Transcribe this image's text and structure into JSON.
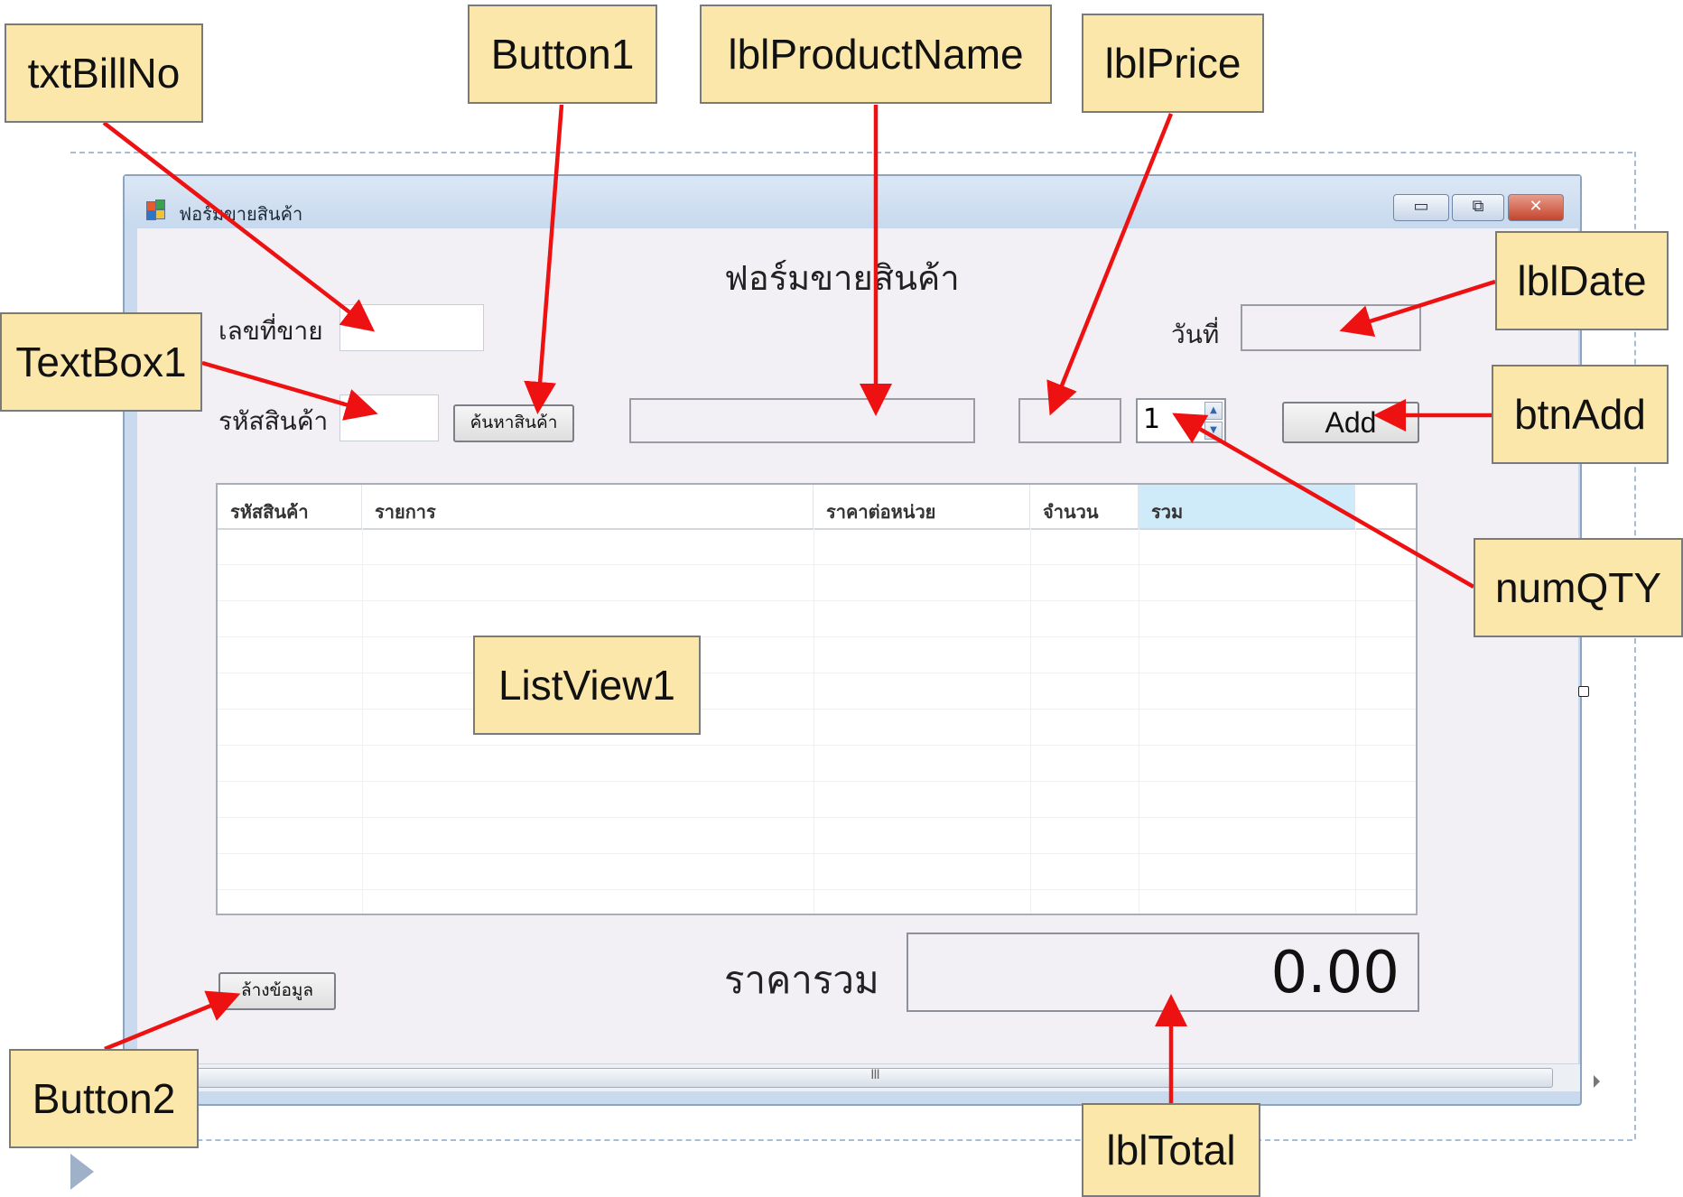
{
  "window": {
    "title": "ฟอร์มขายสินค้า",
    "controls": {
      "minimize": "▭",
      "restore": "⧉",
      "close": "✕"
    }
  },
  "form": {
    "heading": "ฟอร์มขายสินค้า",
    "bill_label": "เลขที่ขาย",
    "product_code_label": "รหัสสินค้า",
    "search_button": "ค้นหาสินค้า",
    "date_label": "วันที่",
    "qty_value": "1",
    "add_button": "Add",
    "clear_button": "ล้างข้อมูล",
    "total_label": "ราคารวม",
    "total_value": "0.00",
    "scroll_grip": "III"
  },
  "listview": {
    "columns": [
      "รหัสสินค้า",
      "รายการ",
      "ราคาต่อหน่วย",
      "จำนวน",
      "รวม"
    ],
    "rows": []
  },
  "callouts": {
    "txtBillNo": "txtBillNo",
    "Button1": "Button1",
    "lblProductName": "lblProductName",
    "lblPrice": "lblPrice",
    "lblDate": "lblDate",
    "TextBox1": "TextBox1",
    "btnAdd": "btnAdd",
    "numQTY": "numQTY",
    "ListView1": "ListView1",
    "Button2": "Button2",
    "lblTotal": "lblTotal"
  },
  "colors": {
    "callout_bg": "#fbe7a9",
    "arrow": "#ee1111",
    "window_frame": "#c9daee"
  }
}
